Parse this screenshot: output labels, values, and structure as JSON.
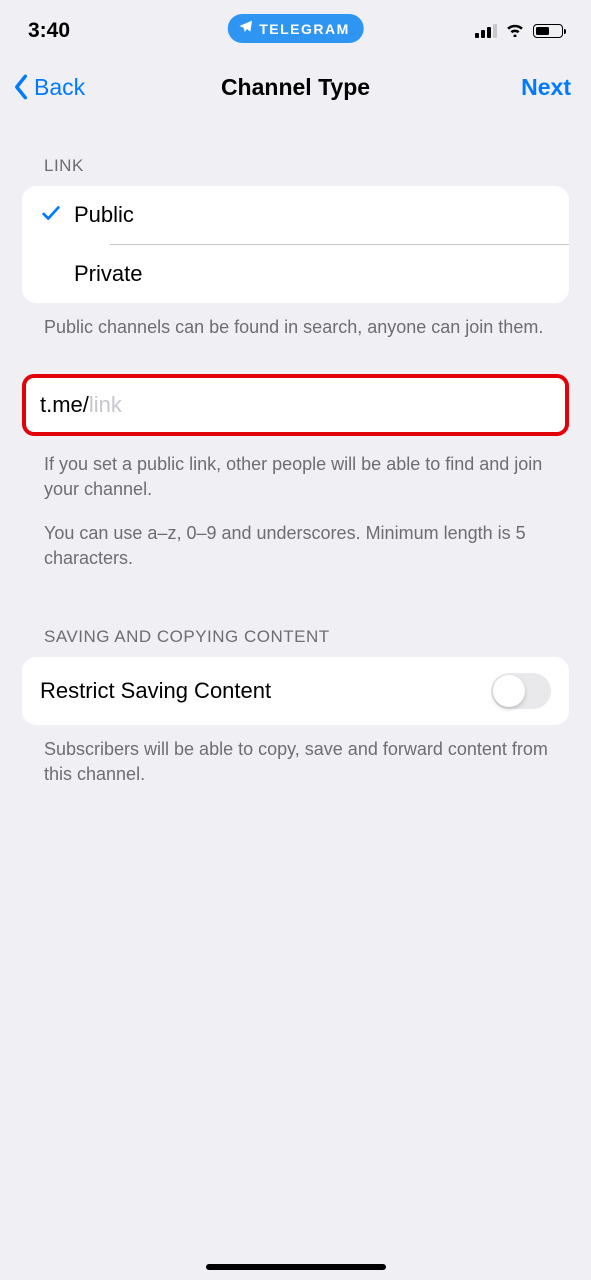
{
  "status": {
    "time": "3:40",
    "app_pill": "TELEGRAM"
  },
  "nav": {
    "back_label": "Back",
    "title": "Channel Type",
    "next_label": "Next"
  },
  "link_section": {
    "header": "LINK",
    "options": {
      "public": "Public",
      "private": "Private"
    },
    "footer": "Public channels can be found in search, anyone can join them."
  },
  "link_input": {
    "prefix": "t.me/",
    "placeholder": "link",
    "value": "",
    "footer1": "If you set a public link, other people will be able to find and join your channel.",
    "footer2": "You can use a–z, 0–9 and underscores. Minimum length is 5 characters."
  },
  "saving_section": {
    "header": "SAVING AND COPYING CONTENT",
    "toggle_label": "Restrict Saving Content",
    "footer": "Subscribers will be able to copy, save and forward content from this channel."
  }
}
